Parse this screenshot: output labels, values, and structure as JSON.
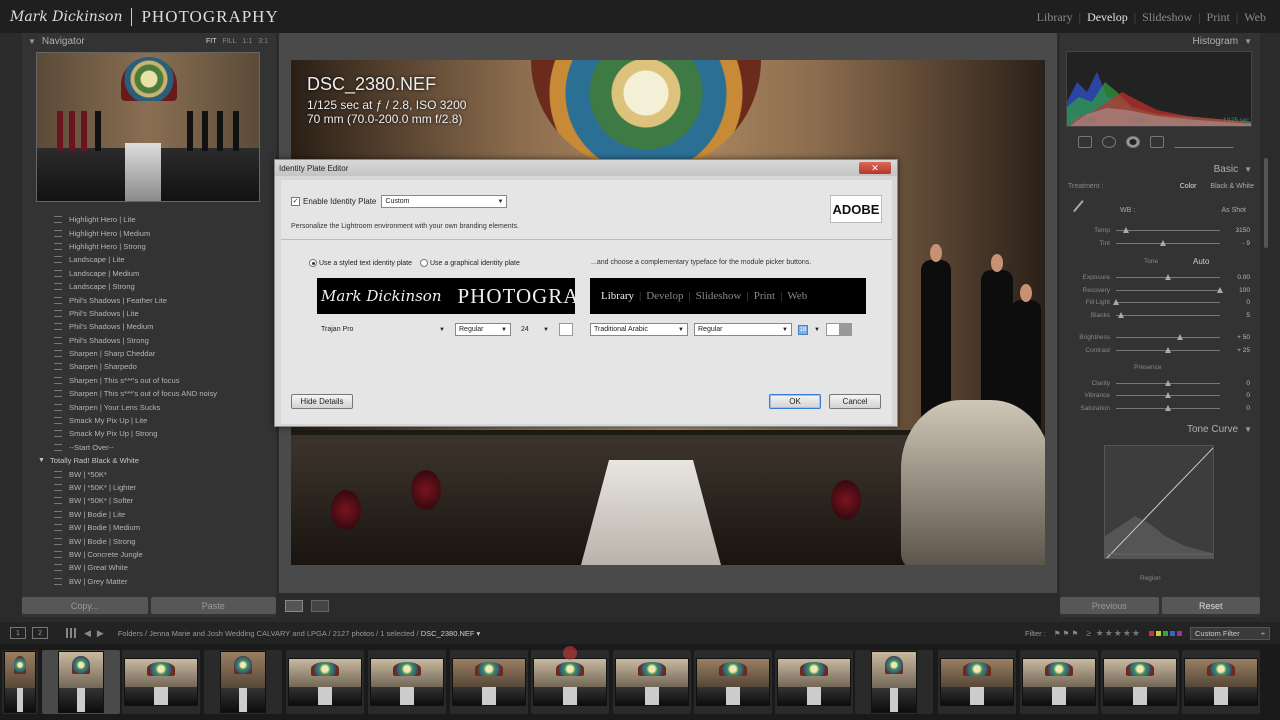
{
  "identity_plate": {
    "signature": "Mark Dickinson",
    "title": "PHOTOGRAPHY"
  },
  "modules": [
    {
      "label": "Library",
      "active": false
    },
    {
      "label": "Develop",
      "active": true
    },
    {
      "label": "Slideshow",
      "active": false
    },
    {
      "label": "Print",
      "active": false
    },
    {
      "label": "Web",
      "active": false
    }
  ],
  "navigator": {
    "title": "Navigator",
    "zoom": [
      "FIT",
      "FILL",
      "1:1",
      "3:1"
    ]
  },
  "presets": [
    {
      "label": "Highlight Hero | Lite",
      "folder": false
    },
    {
      "label": "Highlight Hero | Medium",
      "folder": false
    },
    {
      "label": "Highlight Hero | Strong",
      "folder": false
    },
    {
      "label": "Landscape | Lite",
      "folder": false
    },
    {
      "label": "Landscape | Medium",
      "folder": false
    },
    {
      "label": "Landscape | Strong",
      "folder": false
    },
    {
      "label": "Phil's Shadows | Feather Lite",
      "folder": false
    },
    {
      "label": "Phil's Shadows | Lite",
      "folder": false
    },
    {
      "label": "Phil's Shadows | Medium",
      "folder": false
    },
    {
      "label": "Phil's Shadows | Strong",
      "folder": false
    },
    {
      "label": "Sharpen | Sharp Cheddar",
      "folder": false
    },
    {
      "label": "Sharpen | Sharpedo",
      "folder": false
    },
    {
      "label": "Sharpen | This s***'s out of focus",
      "folder": false
    },
    {
      "label": "Sharpen | This s***'s out of focus AND noisy",
      "folder": false
    },
    {
      "label": "Sharpen | Your Lens Sucks",
      "folder": false
    },
    {
      "label": "Smack My Pix Up | Lite",
      "folder": false
    },
    {
      "label": "Smack My Pix Up | Strong",
      "folder": false
    },
    {
      "label": "--Start Over--",
      "folder": false
    },
    {
      "label": "Totally Rad! Black & White",
      "folder": true
    },
    {
      "label": "BW | *50K*",
      "folder": false
    },
    {
      "label": "BW | *50K* | Lighter",
      "folder": false
    },
    {
      "label": "BW | *50K* | Softer",
      "folder": false
    },
    {
      "label": "BW | Bodie | Lite",
      "folder": false
    },
    {
      "label": "BW | Bodie | Medium",
      "folder": false
    },
    {
      "label": "BW | Bodie | Strong",
      "folder": false
    },
    {
      "label": "BW | Concrete Jungle",
      "folder": false
    },
    {
      "label": "BW | Great White",
      "folder": false
    },
    {
      "label": "BW | Grey Matter",
      "folder": false
    }
  ],
  "left_buttons": {
    "copy": "Copy...",
    "paste": "Paste"
  },
  "photo": {
    "filename": "DSC_2380.NEF",
    "exposure": "1/125 sec at ƒ / 2.8, ISO 3200",
    "lens": "70 mm (70.0-200.0 mm f/2.8)"
  },
  "dialog": {
    "title": "Identity Plate Editor",
    "enable_label": "Enable Identity Plate",
    "enable_checked": true,
    "preset_value": "Custom",
    "adobe_logo": "ADOBE",
    "personalize": "Personalize the Lightroom environment with your own branding elements.",
    "radio_text": "Use a styled text identity plate",
    "radio_graphic": "Use a graphical identity plate",
    "choose_typeface": "...and choose a complementary typeface for the module picker buttons.",
    "plate_signature": "Mark Dickinson",
    "plate_title": "PHOTOGRAPHY",
    "plate_font": "Trajan Pro",
    "plate_style": "Regular",
    "plate_size": "24",
    "module_font": "Traditional Arabic",
    "module_style": "Regular",
    "module_size": "18",
    "hide_details": "Hide Details",
    "ok": "OK",
    "cancel": "Cancel"
  },
  "right": {
    "histogram": "Histogram",
    "histo_labels": [
      "ISO 3200",
      "70 mm",
      "f / 2.8",
      "1/125 sec"
    ],
    "basic": "Basic",
    "treatment_label": "Treatment :",
    "treatment_color": "Color",
    "treatment_bw": "Black & White",
    "wb_label": "WB :",
    "wb_value": "As Shot",
    "tone_label": "Tone",
    "tone_auto": "Auto",
    "presence_label": "Presence",
    "tone_curve": "Tone Curve",
    "region_label": "Region",
    "sliders": [
      {
        "label": "Temp",
        "value": "3150",
        "pos": 0.1
      },
      {
        "label": "Tint",
        "value": "- 9",
        "pos": 0.45
      },
      {
        "label": "Exposure",
        "value": "0.00",
        "pos": 0.5
      },
      {
        "label": "Recovery",
        "value": "100",
        "pos": 1.0
      },
      {
        "label": "Fill Light",
        "value": "0",
        "pos": 0.0
      },
      {
        "label": "Blacks",
        "value": "5",
        "pos": 0.05
      },
      {
        "label": "Brightness",
        "value": "+ 50",
        "pos": 0.62
      },
      {
        "label": "Contrast",
        "value": "+ 25",
        "pos": 0.5
      },
      {
        "label": "Clarity",
        "value": "0",
        "pos": 0.5
      },
      {
        "label": "Vibrance",
        "value": "0",
        "pos": 0.5
      },
      {
        "label": "Saturation",
        "value": "0",
        "pos": 0.5
      }
    ],
    "previous": "Previous",
    "reset": "Reset"
  },
  "filmbar": {
    "num1": "1",
    "num2": "2",
    "path": "Folders / Jenna Marie and Josh Wedding CALVARY and LPGA / 2127 photos / 1 selected /",
    "current_file": "DSC_2380.NEF ▾",
    "filter_label": "Filter :",
    "stars": "≥ ★★★★★",
    "filter_value": "Custom Filter"
  },
  "colors": {
    "accent": "#e4e4e4",
    "panel": "#333333",
    "dialog": "#e5e5e5"
  }
}
